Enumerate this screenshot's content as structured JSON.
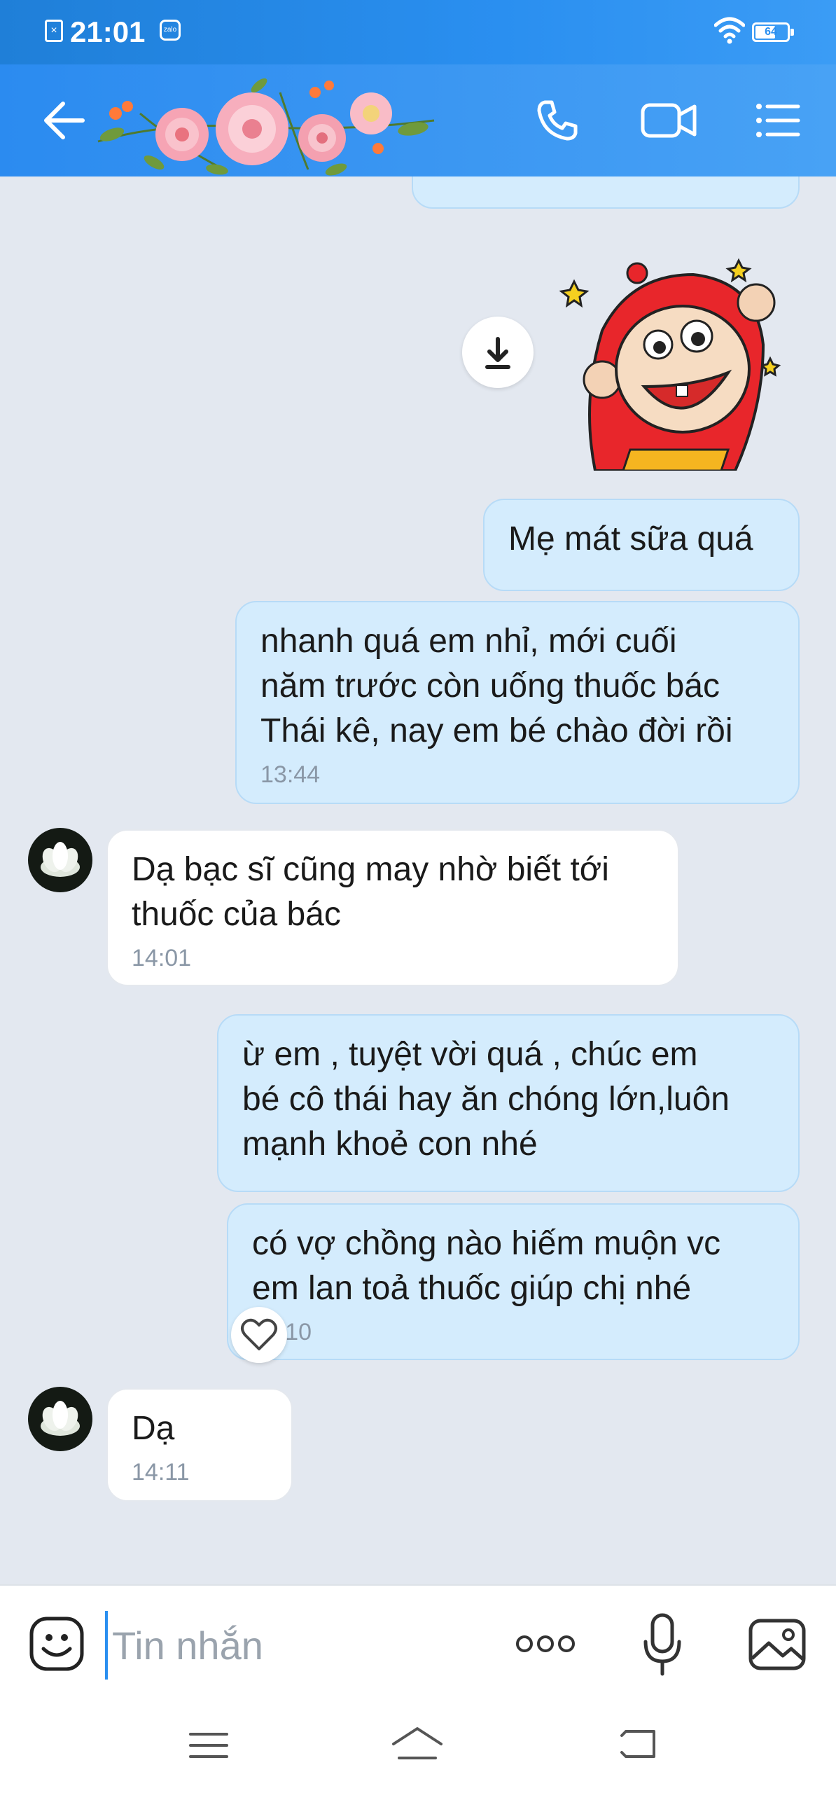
{
  "status_bar": {
    "time": "21:01",
    "battery": "64",
    "battery_fraction": 0.64
  },
  "header": {
    "icons": [
      "back-arrow-icon",
      "flowers-decoration",
      "phone-icon",
      "video-camera-icon",
      "menu-list-icon"
    ]
  },
  "messages": [
    {
      "sender": "me",
      "text": "Mẹ mát sữa quá",
      "time": ""
    },
    {
      "sender": "me",
      "text": "nhanh quá em nhỉ, mới cuối\nnăm trước còn uống thuốc bác\nThái kê, nay em bé chào đời rồi",
      "time": "13:44"
    },
    {
      "sender": "them",
      "text": "Dạ bạc sĩ cũng may nhờ biết tới\nthuốc của bác",
      "time": "14:01"
    },
    {
      "sender": "me",
      "text": "ừ em , tuyệt vời quá , chúc em\nbé cô thái hay ăn chóng lớn,luôn\nmạnh khoẻ con nhé",
      "time": ""
    },
    {
      "sender": "me",
      "text": "có vợ chồng nào hiếm muộn vc\nem lan toả thuốc giúp chị nhé",
      "time": "14:10"
    },
    {
      "sender": "them",
      "text": "Dạ",
      "time": "14:11"
    }
  ],
  "input": {
    "placeholder": "Tin nhắn"
  },
  "colors": {
    "header": "#2b8bf0",
    "my_bubble": "#d4ecfd",
    "their_bubble": "#ffffff",
    "chat_bg": "#e3e8f0"
  }
}
